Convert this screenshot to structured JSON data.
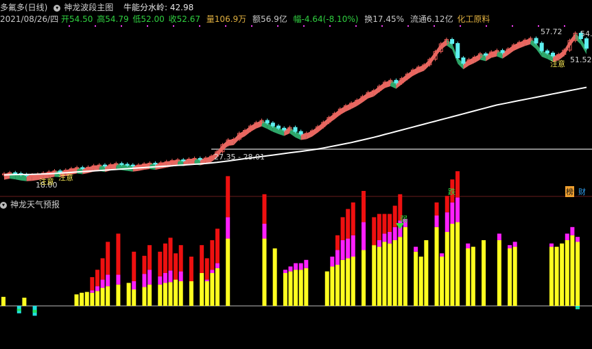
{
  "header": {
    "stock_name": "多氟多(日线)",
    "main_indicator": "神龙波段主图",
    "water_label": "牛能分水岭: 42.98",
    "date": "2021/08/26/四",
    "open": "开54.50",
    "high": "高54.79",
    "low": "低52.00",
    "close": "收52.67",
    "volume": "量106.9万",
    "amount": "额56.9亿",
    "change": "幅-4.64(-8.10%)",
    "turnover": "换17.45%",
    "float": "流通6.12亿",
    "industry": "化工原料"
  },
  "lower_panel": {
    "title": "神龙天气预报"
  },
  "annotations": {
    "high_price": "57.72",
    "right_cut_high": "54.",
    "right_price": "51.52",
    "range_label": "27.35 - 28.01",
    "low_price": "18.00",
    "attention1": "注意",
    "attention2": "注意",
    "attention3": "注意",
    "weak": "弱",
    "fall": "跌",
    "hot": "榜",
    "finance": "财"
  },
  "colors": {
    "up_body": "#f0605a",
    "down_body": "#5ef0f0",
    "ma_line": "#ffffff",
    "ribbon_up": "#f07068",
    "ribbon_down": "#30b070",
    "bar_yellow": "#ffff20",
    "bar_magenta": "#ff20ff",
    "bar_red": "#ee1010",
    "bar_cyan": "#20e0e0",
    "bar_green": "#20e060"
  },
  "chart_data": [
    {
      "type": "candlestick",
      "title": "神龙波段主图",
      "y_scale": "price",
      "ylim": [
        16,
        58
      ],
      "close": [
        18.6,
        18.9,
        18.7,
        18.4,
        18.2,
        18.3,
        18.5,
        18.8,
        19.1,
        19.4,
        19.3,
        19.6,
        20.0,
        20.3,
        20.1,
        20.4,
        20.8,
        21.0,
        20.7,
        21.1,
        21.4,
        21.2,
        21.0,
        20.8,
        21.0,
        21.3,
        21.5,
        21.3,
        21.6,
        21.9,
        22.2,
        22.4,
        22.3,
        22.6,
        22.8,
        22.5,
        22.9,
        23.4,
        24.6,
        26.5,
        27.8,
        28.0,
        29.6,
        30.4,
        31.6,
        32.5,
        33.1,
        32.4,
        31.6,
        31.0,
        30.5,
        31.2,
        30.1,
        29.4,
        29.6,
        30.3,
        31.4,
        32.6,
        33.9,
        35.0,
        36.2,
        37.1,
        37.8,
        38.6,
        39.6,
        40.7,
        41.2,
        42.4,
        43.5,
        44.0,
        43.3,
        44.5,
        45.7,
        46.8,
        47.6,
        48.2,
        49.7,
        51.8,
        53.9,
        55.1,
        54.0,
        50.1,
        48.6,
        49.6,
        50.3,
        51.2,
        50.8,
        51.7,
        52.1,
        51.5,
        52.5,
        53.6,
        54.3,
        54.9,
        55.4,
        54.1,
        52.0,
        51.4,
        50.6,
        51.0,
        52.2,
        54.8,
        56.8,
        55.3,
        52.7
      ],
      "ma_line": [
        18.3,
        18.35,
        18.4,
        18.42,
        18.44,
        18.46,
        18.5,
        18.55,
        18.6,
        18.7,
        18.8,
        18.9,
        19.0,
        19.1,
        19.2,
        19.3,
        19.4,
        19.5,
        19.6,
        19.7,
        19.8,
        19.9,
        20.0,
        20.1,
        20.2,
        20.3,
        20.4,
        20.5,
        20.6,
        20.7,
        20.8,
        20.9,
        21.0,
        21.1,
        21.2,
        21.3,
        21.4,
        21.55,
        21.7,
        21.9,
        22.1,
        22.3,
        22.5,
        22.7,
        22.9,
        23.1,
        23.3,
        23.5,
        23.7,
        23.9,
        24.1,
        24.3,
        24.5,
        24.7,
        24.9,
        25.1,
        25.35,
        25.6,
        25.9,
        26.2,
        26.5,
        26.8,
        27.1,
        27.45,
        27.8,
        28.15,
        28.5,
        28.9,
        29.3,
        29.7,
        30.1,
        30.5,
        30.9,
        31.3,
        31.7,
        32.1,
        32.5,
        32.9,
        33.3,
        33.7,
        34.1,
        34.5,
        34.9,
        35.3,
        35.7,
        36.1,
        36.5,
        36.9,
        37.3,
        37.6,
        37.9,
        38.2,
        38.5,
        38.8,
        39.1,
        39.4,
        39.7,
        40.0,
        40.3,
        40.6,
        40.9,
        41.2,
        41.5,
        41.8,
        42.1
      ],
      "annotations": [
        "57.72",
        "27.35 - 28.01",
        "18.00",
        "51.52"
      ]
    },
    {
      "type": "bar",
      "title": "神龙天气预报",
      "stacked": true,
      "yellow": [
        0.55,
        0,
        0,
        0,
        0.5,
        0,
        0,
        0,
        0,
        0,
        0,
        0,
        0,
        0,
        0.7,
        0.8,
        0.85,
        0.8,
        0.9,
        1.1,
        1.2,
        0,
        1.3,
        0,
        1.4,
        1.0,
        0,
        1.15,
        1.3,
        0,
        1.3,
        1.4,
        1.45,
        1.6,
        1.5,
        0,
        1.5,
        0,
        2.0,
        1.5,
        2.0,
        2.3,
        0,
        4.1,
        0,
        0,
        0,
        0,
        0,
        0,
        4.1,
        0,
        3.5,
        0,
        2.0,
        2.1,
        2.2,
        2.2,
        2.3,
        0,
        0,
        0,
        2.1,
        2.4,
        2.5,
        2.8,
        2.9,
        3.0,
        0,
        3.4,
        0,
        3.7,
        3.6,
        3.9,
        3.8,
        4.0,
        4.2,
        4.8,
        0,
        3.3,
        3.0,
        4.0,
        0,
        4.8,
        3.0,
        4.5,
        5.0,
        5.1,
        0,
        3.5,
        3.6,
        0,
        4.0,
        0,
        0,
        4.0,
        0,
        3.5,
        3.6,
        0,
        0,
        0,
        0,
        0,
        0,
        3.6,
        3.6,
        3.8,
        4.0,
        4.3,
        3.9
      ],
      "magenta": [
        0,
        0,
        0,
        0,
        0,
        0,
        0,
        0,
        0,
        0,
        0,
        0,
        0,
        0,
        0,
        0,
        0,
        0.15,
        0.3,
        0.5,
        0.7,
        0,
        0.6,
        0,
        0,
        0.5,
        0,
        0.8,
        0.9,
        0,
        0.5,
        0.6,
        0.7,
        0,
        0.6,
        0,
        0,
        0,
        0,
        0.1,
        0.2,
        0.3,
        0,
        1.3,
        0,
        0,
        0,
        0,
        0,
        0,
        0.9,
        0,
        0,
        0,
        0.2,
        0.3,
        0.4,
        0.4,
        0.5,
        0,
        0,
        0,
        0,
        0.6,
        0.9,
        1.2,
        1.2,
        1.3,
        0,
        1.7,
        0,
        0,
        0.4,
        0.5,
        0.7,
        0.8,
        1.0,
        0.5,
        0,
        0.3,
        0,
        0,
        0,
        0.7,
        0.2,
        1.2,
        1.3,
        1.5,
        0,
        0.3,
        0,
        0,
        0,
        0,
        0,
        0.4,
        0,
        0.2,
        0.3,
        0,
        0,
        0,
        0,
        0,
        0,
        0.2,
        0,
        0,
        0.4,
        0.5,
        0.3
      ],
      "red": [
        0,
        0,
        0,
        0,
        0,
        0,
        0,
        0,
        0,
        0,
        0,
        0,
        0,
        0,
        0,
        0,
        0,
        0.8,
        1.0,
        1.3,
        2.0,
        0,
        2.5,
        0,
        0,
        1.8,
        0,
        1.1,
        1.5,
        0,
        1.5,
        1.8,
        2.0,
        1.6,
        1.6,
        0,
        1.5,
        0,
        1.7,
        1.3,
        1.8,
        2.1,
        0,
        2.5,
        0,
        0,
        0,
        0,
        0,
        0,
        1.8,
        0,
        0,
        0,
        0,
        0,
        0,
        0,
        0,
        0,
        0,
        0,
        0,
        0,
        0.9,
        1.4,
        1.8,
        2.0,
        0,
        1.9,
        0,
        1.7,
        1.6,
        1.2,
        1.1,
        1.3,
        1.6,
        0,
        0,
        0,
        0,
        0,
        0,
        0.8,
        0,
        1.0,
        1.4,
        1.6,
        0,
        0,
        0,
        0,
        0,
        0,
        0,
        0,
        0,
        0,
        0,
        0,
        0,
        0,
        0,
        0,
        0,
        0,
        0,
        0,
        0,
        0,
        0
      ],
      "cyan": [
        0,
        0,
        0,
        -0.45,
        0,
        0,
        -0.6,
        0,
        0,
        0,
        0,
        0,
        0,
        0,
        0,
        0,
        0,
        0,
        0,
        0,
        0,
        0,
        0,
        0,
        0,
        0,
        0,
        0,
        0,
        0,
        0,
        0,
        0,
        0,
        0,
        0,
        0,
        0,
        0,
        0,
        0,
        0,
        0,
        0,
        0,
        0,
        0,
        0,
        0,
        0,
        0,
        0,
        0,
        0,
        0,
        0,
        0,
        0,
        0,
        0,
        0,
        0,
        0,
        0,
        0,
        0,
        0,
        0,
        0,
        0,
        0,
        0,
        0,
        0,
        0,
        0,
        0,
        0,
        0,
        0,
        0,
        0,
        0,
        0,
        0,
        0,
        0,
        0,
        0,
        0,
        0,
        0,
        0,
        0,
        0,
        0,
        0,
        0,
        0,
        0,
        0,
        0,
        0,
        0,
        0,
        0,
        0,
        0,
        0,
        0,
        -0.2
      ]
    }
  ]
}
